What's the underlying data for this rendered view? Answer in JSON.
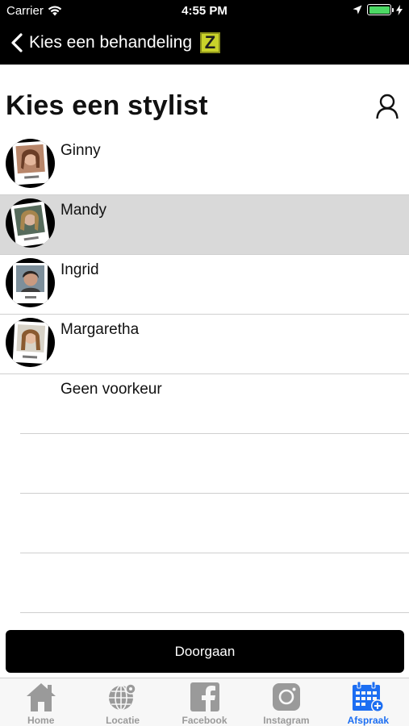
{
  "status_bar": {
    "carrier": "Carrier",
    "time": "4:55 PM"
  },
  "nav": {
    "title": "Kies een behandeling",
    "logo_letter": "Z"
  },
  "page": {
    "heading": "Kies een stylist"
  },
  "stylists": [
    {
      "name": "Ginny",
      "selected": false
    },
    {
      "name": "Mandy",
      "selected": true
    },
    {
      "name": "Ingrid",
      "selected": false
    },
    {
      "name": "Margaretha",
      "selected": false
    }
  ],
  "no_preference": "Geen voorkeur",
  "cta": {
    "label": "Doorgaan"
  },
  "tabs": [
    {
      "label": "Home",
      "icon": "home-icon"
    },
    {
      "label": "Locatie",
      "icon": "globe-icon"
    },
    {
      "label": "Facebook",
      "icon": "facebook-icon"
    },
    {
      "label": "Instagram",
      "icon": "instagram-icon"
    },
    {
      "label": "Afspraak",
      "icon": "calendar-add-icon",
      "active": true
    }
  ],
  "colors": {
    "accent": "#1c6ef2",
    "selected_row": "#d9d9d9",
    "logo": "#c9d22a",
    "battery": "#4cd964"
  }
}
